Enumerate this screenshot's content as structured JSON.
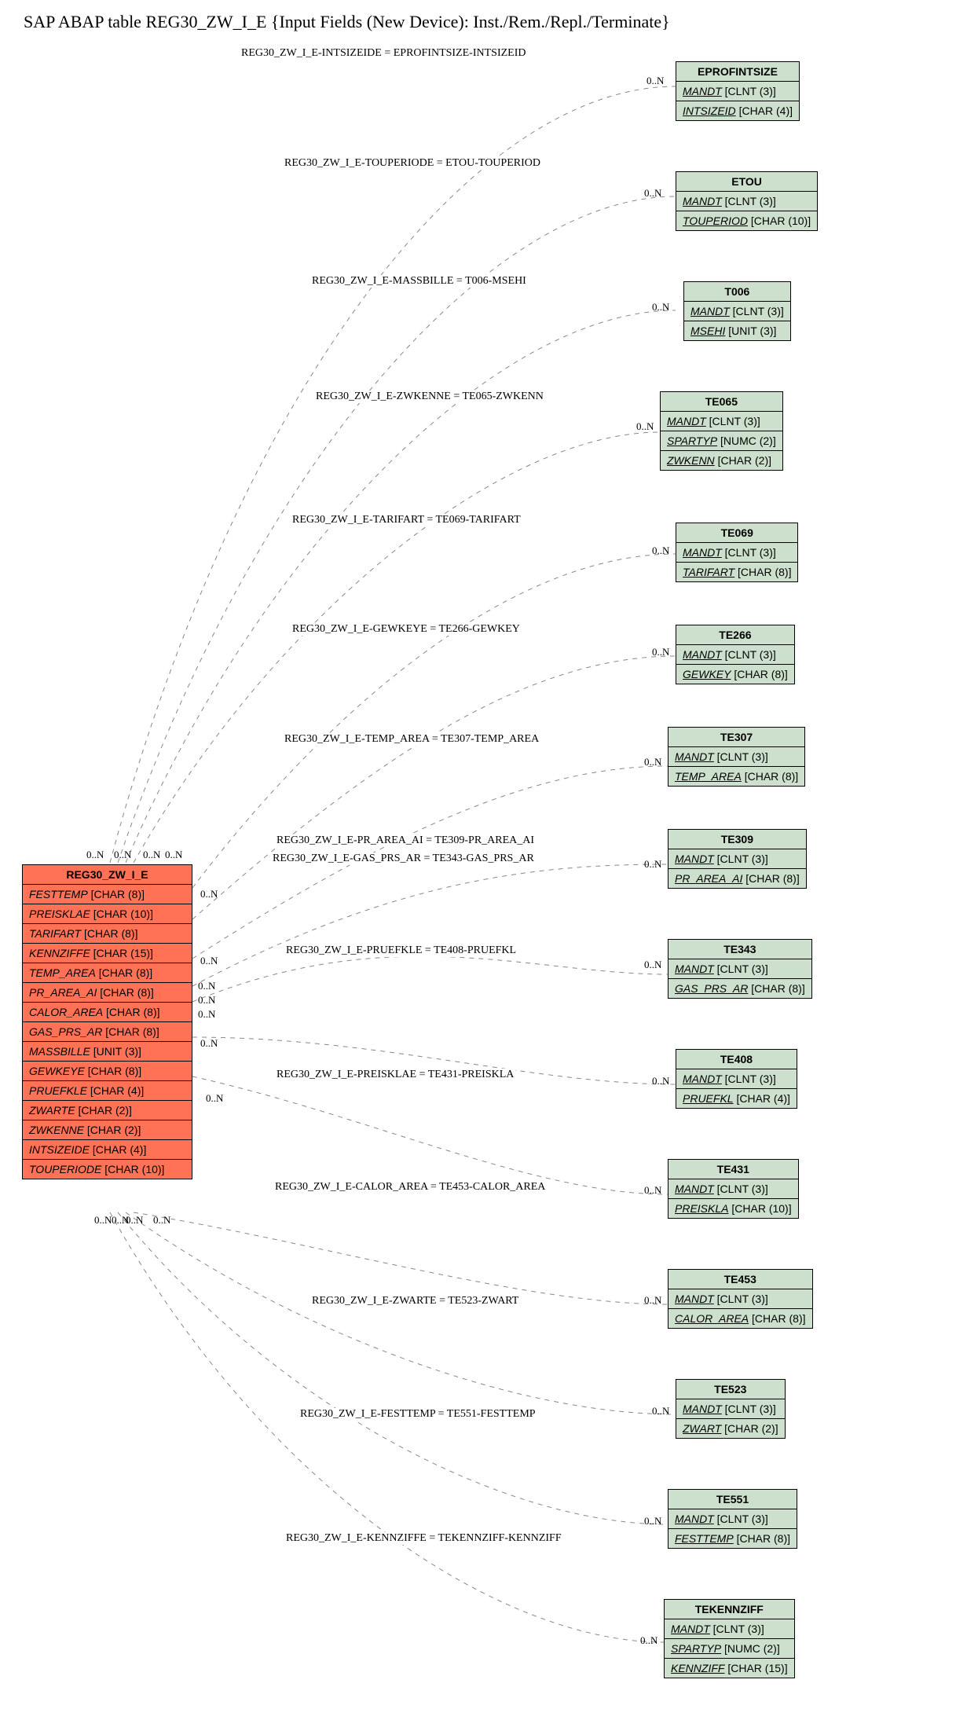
{
  "title": "SAP ABAP table REG30_ZW_I_E {Input Fields (New Device): Inst./Rem./Repl./Terminate}",
  "main": {
    "name": "REG30_ZW_I_E",
    "fields": [
      {
        "name": "FESTTEMP",
        "type": "[CHAR (8)]"
      },
      {
        "name": "PREISKLAE",
        "type": "[CHAR (10)]"
      },
      {
        "name": "TARIFART",
        "type": "[CHAR (8)]"
      },
      {
        "name": "KENNZIFFE",
        "type": "[CHAR (15)]"
      },
      {
        "name": "TEMP_AREA",
        "type": "[CHAR (8)]"
      },
      {
        "name": "PR_AREA_AI",
        "type": "[CHAR (8)]"
      },
      {
        "name": "CALOR_AREA",
        "type": "[CHAR (8)]"
      },
      {
        "name": "GAS_PRS_AR",
        "type": "[CHAR (8)]"
      },
      {
        "name": "MASSBILLE",
        "type": "[UNIT (3)]"
      },
      {
        "name": "GEWKEYE",
        "type": "[CHAR (8)]"
      },
      {
        "name": "PRUEFKLE",
        "type": "[CHAR (4)]"
      },
      {
        "name": "ZWARTE",
        "type": "[CHAR (2)]"
      },
      {
        "name": "ZWKENNE",
        "type": "[CHAR (2)]"
      },
      {
        "name": "INTSIZEIDE",
        "type": "[CHAR (4)]"
      },
      {
        "name": "TOUPERIODE",
        "type": "[CHAR (10)]"
      }
    ]
  },
  "rel": [
    {
      "name": "EPROFINTSIZE",
      "fields": [
        {
          "n": "MANDT",
          "t": "[CLNT (3)]",
          "u": true
        },
        {
          "n": "INTSIZEID",
          "t": "[CHAR (4)]",
          "u": true
        }
      ],
      "edge": "REG30_ZW_I_E-INTSIZEIDE = EPROFINTSIZE-INTSIZEID"
    },
    {
      "name": "ETOU",
      "fields": [
        {
          "n": "MANDT",
          "t": "[CLNT (3)]",
          "u": true
        },
        {
          "n": "TOUPERIOD",
          "t": "[CHAR (10)]",
          "u": true
        }
      ],
      "edge": "REG30_ZW_I_E-TOUPERIODE = ETOU-TOUPERIOD"
    },
    {
      "name": "T006",
      "fields": [
        {
          "n": "MANDT",
          "t": "[CLNT (3)]",
          "u": true
        },
        {
          "n": "MSEHI",
          "t": "[UNIT (3)]",
          "u": true
        }
      ],
      "edge": "REG30_ZW_I_E-MASSBILLE = T006-MSEHI"
    },
    {
      "name": "TE065",
      "fields": [
        {
          "n": "MANDT",
          "t": "[CLNT (3)]",
          "u": true
        },
        {
          "n": "SPARTYP",
          "t": "[NUMC (2)]",
          "u": true
        },
        {
          "n": "ZWKENN",
          "t": "[CHAR (2)]",
          "u": true
        }
      ],
      "edge": "REG30_ZW_I_E-ZWKENNE = TE065-ZWKENN"
    },
    {
      "name": "TE069",
      "fields": [
        {
          "n": "MANDT",
          "t": "[CLNT (3)]",
          "u": true
        },
        {
          "n": "TARIFART",
          "t": "[CHAR (8)]",
          "u": true
        }
      ],
      "edge": "REG30_ZW_I_E-TARIFART = TE069-TARIFART"
    },
    {
      "name": "TE266",
      "fields": [
        {
          "n": "MANDT",
          "t": "[CLNT (3)]",
          "u": true
        },
        {
          "n": "GEWKEY",
          "t": "[CHAR (8)]",
          "u": true
        }
      ],
      "edge": "REG30_ZW_I_E-GEWKEYE = TE266-GEWKEY"
    },
    {
      "name": "TE307",
      "fields": [
        {
          "n": "MANDT",
          "t": "[CLNT (3)]",
          "u": true
        },
        {
          "n": "TEMP_AREA",
          "t": "[CHAR (8)]",
          "u": true
        }
      ],
      "edge": "REG30_ZW_I_E-TEMP_AREA = TE307-TEMP_AREA"
    },
    {
      "name": "TE309",
      "fields": [
        {
          "n": "MANDT",
          "t": "[CLNT (3)]",
          "u": true
        },
        {
          "n": "PR_AREA_AI",
          "t": "[CHAR (8)]",
          "u": true
        }
      ],
      "edge": "REG30_ZW_I_E-PR_AREA_AI = TE309-PR_AREA_AI"
    },
    {
      "name": "TE343",
      "fields": [
        {
          "n": "MANDT",
          "t": "[CLNT (3)]",
          "u": true
        },
        {
          "n": "GAS_PRS_AR",
          "t": "[CHAR (8)]",
          "u": true
        }
      ],
      "edge": "REG30_ZW_I_E-GAS_PRS_AR = TE343-GAS_PRS_AR"
    },
    {
      "name": "TE408",
      "fields": [
        {
          "n": "MANDT",
          "t": "[CLNT (3)]",
          "u": true
        },
        {
          "n": "PRUEFKL",
          "t": "[CHAR (4)]",
          "u": true
        }
      ],
      "edge": "REG30_ZW_I_E-PRUEFKLE = TE408-PRUEFKL"
    },
    {
      "name": "TE431",
      "fields": [
        {
          "n": "MANDT",
          "t": "[CLNT (3)]",
          "u": true
        },
        {
          "n": "PREISKLA",
          "t": "[CHAR (10)]",
          "u": true
        }
      ],
      "edge": "REG30_ZW_I_E-PREISKLAE = TE431-PREISKLA"
    },
    {
      "name": "TE453",
      "fields": [
        {
          "n": "MANDT",
          "t": "[CLNT (3)]",
          "u": true
        },
        {
          "n": "CALOR_AREA",
          "t": "[CHAR (8)]",
          "u": true
        }
      ],
      "edge": "REG30_ZW_I_E-CALOR_AREA = TE453-CALOR_AREA"
    },
    {
      "name": "TE523",
      "fields": [
        {
          "n": "MANDT",
          "t": "[CLNT (3)]",
          "u": true
        },
        {
          "n": "ZWART",
          "t": "[CHAR (2)]",
          "u": true
        }
      ],
      "edge": "REG30_ZW_I_E-ZWARTE = TE523-ZWART"
    },
    {
      "name": "TE551",
      "fields": [
        {
          "n": "MANDT",
          "t": "[CLNT (3)]",
          "u": true
        },
        {
          "n": "FESTTEMP",
          "t": "[CHAR (8)]",
          "u": true
        }
      ],
      "edge": "REG30_ZW_I_E-FESTTEMP = TE551-FESTTEMP"
    },
    {
      "name": "TEKENNZIFF",
      "fields": [
        {
          "n": "MANDT",
          "t": "[CLNT (3)]",
          "u": true
        },
        {
          "n": "SPARTYP",
          "t": "[NUMC (2)]",
          "u": true
        },
        {
          "n": "KENNZIFF",
          "t": "[CHAR (15)]",
          "u": true
        }
      ],
      "edge": "REG30_ZW_I_E-KENNZIFFE = TEKENNZIFF-KENNZIFF"
    }
  ],
  "card": "0..N",
  "chart_data": {
    "type": "table",
    "description": "Entity-relationship diagram: SAP ABAP table REG30_ZW_I_E with foreign-key relationships to 15 check tables. All cardinalities are 0..N on both ends.",
    "main_table": "REG30_ZW_I_E",
    "main_fields": [
      "FESTTEMP CHAR(8)",
      "PREISKLAE CHAR(10)",
      "TARIFART CHAR(8)",
      "KENNZIFFE CHAR(15)",
      "TEMP_AREA CHAR(8)",
      "PR_AREA_AI CHAR(8)",
      "CALOR_AREA CHAR(8)",
      "GAS_PRS_AR CHAR(8)",
      "MASSBILLE UNIT(3)",
      "GEWKEYE CHAR(8)",
      "PRUEFKLE CHAR(4)",
      "ZWARTE CHAR(2)",
      "ZWKENNE CHAR(2)",
      "INTSIZEIDE CHAR(4)",
      "TOUPERIODE CHAR(10)"
    ],
    "relations": [
      {
        "from": "REG30_ZW_I_E.INTSIZEIDE",
        "to": "EPROFINTSIZE.INTSIZEID",
        "card": "0..N:0..N"
      },
      {
        "from": "REG30_ZW_I_E.TOUPERIODE",
        "to": "ETOU.TOUPERIOD",
        "card": "0..N:0..N"
      },
      {
        "from": "REG30_ZW_I_E.MASSBILLE",
        "to": "T006.MSEHI",
        "card": "0..N:0..N"
      },
      {
        "from": "REG30_ZW_I_E.ZWKENNE",
        "to": "TE065.ZWKENN",
        "card": "0..N:0..N"
      },
      {
        "from": "REG30_ZW_I_E.TARIFART",
        "to": "TE069.TARIFART",
        "card": "0..N:0..N"
      },
      {
        "from": "REG30_ZW_I_E.GEWKEYE",
        "to": "TE266.GEWKEY",
        "card": "0..N:0..N"
      },
      {
        "from": "REG30_ZW_I_E.TEMP_AREA",
        "to": "TE307.TEMP_AREA",
        "card": "0..N:0..N"
      },
      {
        "from": "REG30_ZW_I_E.PR_AREA_AI",
        "to": "TE309.PR_AREA_AI",
        "card": "0..N:0..N"
      },
      {
        "from": "REG30_ZW_I_E.GAS_PRS_AR",
        "to": "TE343.GAS_PRS_AR",
        "card": "0..N:0..N"
      },
      {
        "from": "REG30_ZW_I_E.PRUEFKLE",
        "to": "TE408.PRUEFKL",
        "card": "0..N:0..N"
      },
      {
        "from": "REG30_ZW_I_E.PREISKLAE",
        "to": "TE431.PREISKLA",
        "card": "0..N:0..N"
      },
      {
        "from": "REG30_ZW_I_E.CALOR_AREA",
        "to": "TE453.CALOR_AREA",
        "card": "0..N:0..N"
      },
      {
        "from": "REG30_ZW_I_E.ZWARTE",
        "to": "TE523.ZWART",
        "card": "0..N:0..N"
      },
      {
        "from": "REG30_ZW_I_E.FESTTEMP",
        "to": "TE551.FESTTEMP",
        "card": "0..N:0..N"
      },
      {
        "from": "REG30_ZW_I_E.KENNZIFFE",
        "to": "TEKENNZIFF.KENNZIFF",
        "card": "0..N:0..N"
      }
    ]
  }
}
